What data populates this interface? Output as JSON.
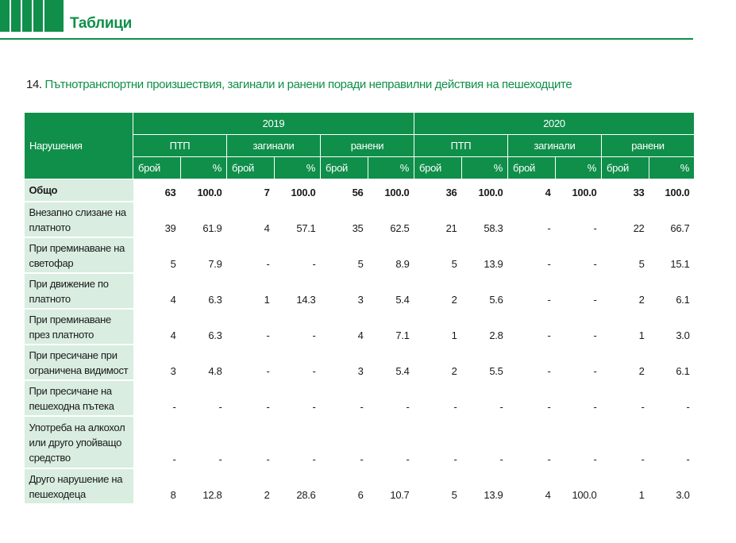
{
  "colors": {
    "accent": "#0f8f4a",
    "label_bg": "#d9ede1"
  },
  "header": {
    "section_title": "Таблици"
  },
  "table_title": {
    "number": "14.",
    "text": "Пътнотранспортни произшествия, загинали и ранени поради неправилни действия на пешеходците"
  },
  "table": {
    "row_header": "Нарушения",
    "years": [
      "2019",
      "2020"
    ],
    "groups": [
      "ПТП",
      "загинали",
      "ранени",
      "ПТП",
      "загинали",
      "ранени"
    ],
    "sub": [
      "брой",
      "%",
      "брой",
      "%",
      "брой",
      "%",
      "брой",
      "%",
      "брой",
      "%",
      "брой",
      "%"
    ],
    "rows": [
      {
        "label": "Общо",
        "values": [
          "63",
          "100.0",
          "7",
          "100.0",
          "56",
          "100.0",
          "36",
          "100.0",
          "4",
          "100.0",
          "33",
          "100.0"
        ]
      },
      {
        "label": "Внезапно слизане на платното",
        "values": [
          "39",
          "61.9",
          "4",
          "57.1",
          "35",
          "62.5",
          "21",
          "58.3",
          "-",
          "-",
          "22",
          "66.7"
        ]
      },
      {
        "label": "При преминаване на светофар",
        "values": [
          "5",
          "7.9",
          "-",
          "-",
          "5",
          "8.9",
          "5",
          "13.9",
          "-",
          "-",
          "5",
          "15.1"
        ]
      },
      {
        "label": "При движение по платното",
        "values": [
          "4",
          "6.3",
          "1",
          "14.3",
          "3",
          "5.4",
          "2",
          "5.6",
          "-",
          "-",
          "2",
          "6.1"
        ]
      },
      {
        "label": "При преминаване през платното",
        "values": [
          "4",
          "6.3",
          "-",
          "-",
          "4",
          "7.1",
          "1",
          "2.8",
          "-",
          "-",
          "1",
          "3.0"
        ]
      },
      {
        "label": "При пресичане при ограничена видимост",
        "values": [
          "3",
          "4.8",
          "-",
          "-",
          "3",
          "5.4",
          "2",
          "5.5",
          "-",
          "-",
          "2",
          "6.1"
        ]
      },
      {
        "label": "При пресичане на пешеходна пътека",
        "values": [
          "-",
          "-",
          "-",
          "-",
          "-",
          "-",
          "-",
          "-",
          "-",
          "-",
          "-",
          "-"
        ]
      },
      {
        "label": "Употреба на алкохол или друго упойващо средство",
        "values": [
          "-",
          "-",
          "-",
          "-",
          "-",
          "-",
          "-",
          "-",
          "-",
          "-",
          "-",
          "-"
        ]
      },
      {
        "label": "Друго нарушение на пешеходеца",
        "values": [
          "8",
          "12.8",
          "2",
          "28.6",
          "6",
          "10.7",
          "5",
          "13.9",
          "4",
          "100.0",
          "1",
          "3.0"
        ]
      }
    ]
  }
}
